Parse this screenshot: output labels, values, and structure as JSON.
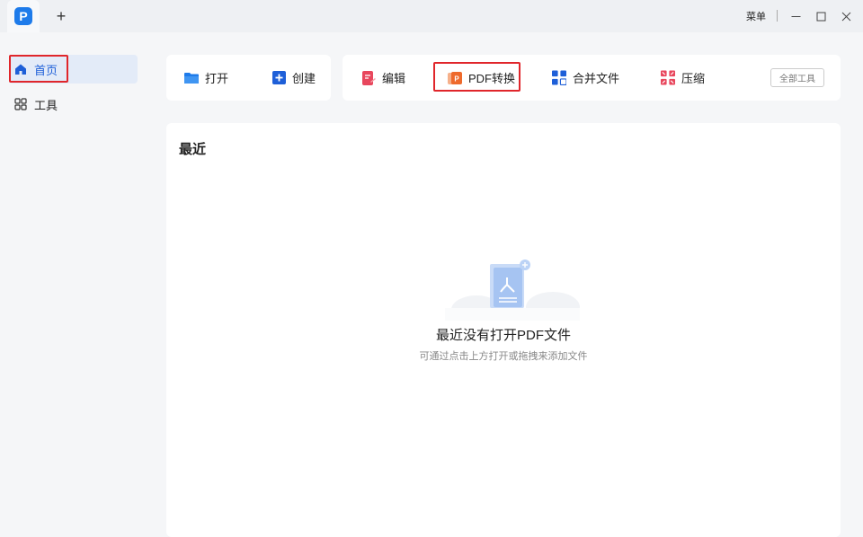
{
  "titlebar": {
    "app_logo_letter": "P",
    "new_tab": "+",
    "menu_label": "菜单"
  },
  "sidebar": {
    "items": [
      {
        "label": "首页",
        "icon": "home-icon",
        "active": true
      },
      {
        "label": "工具",
        "icon": "grid-icon",
        "active": false
      }
    ]
  },
  "toolbar": {
    "open_label": "打开",
    "create_label": "创建",
    "edit_label": "编辑",
    "convert_label": "PDF转换",
    "merge_label": "合并文件",
    "compress_label": "压缩",
    "all_tools_label": "全部工具"
  },
  "recent": {
    "title": "最近",
    "empty_title": "最近没有打开PDF文件",
    "empty_hint": "可通过点击上方打开或拖拽来添加文件"
  },
  "colors": {
    "accent": "#1e7bea",
    "highlight_box": "#e0262b",
    "active_bg": "#e3ebf8"
  }
}
